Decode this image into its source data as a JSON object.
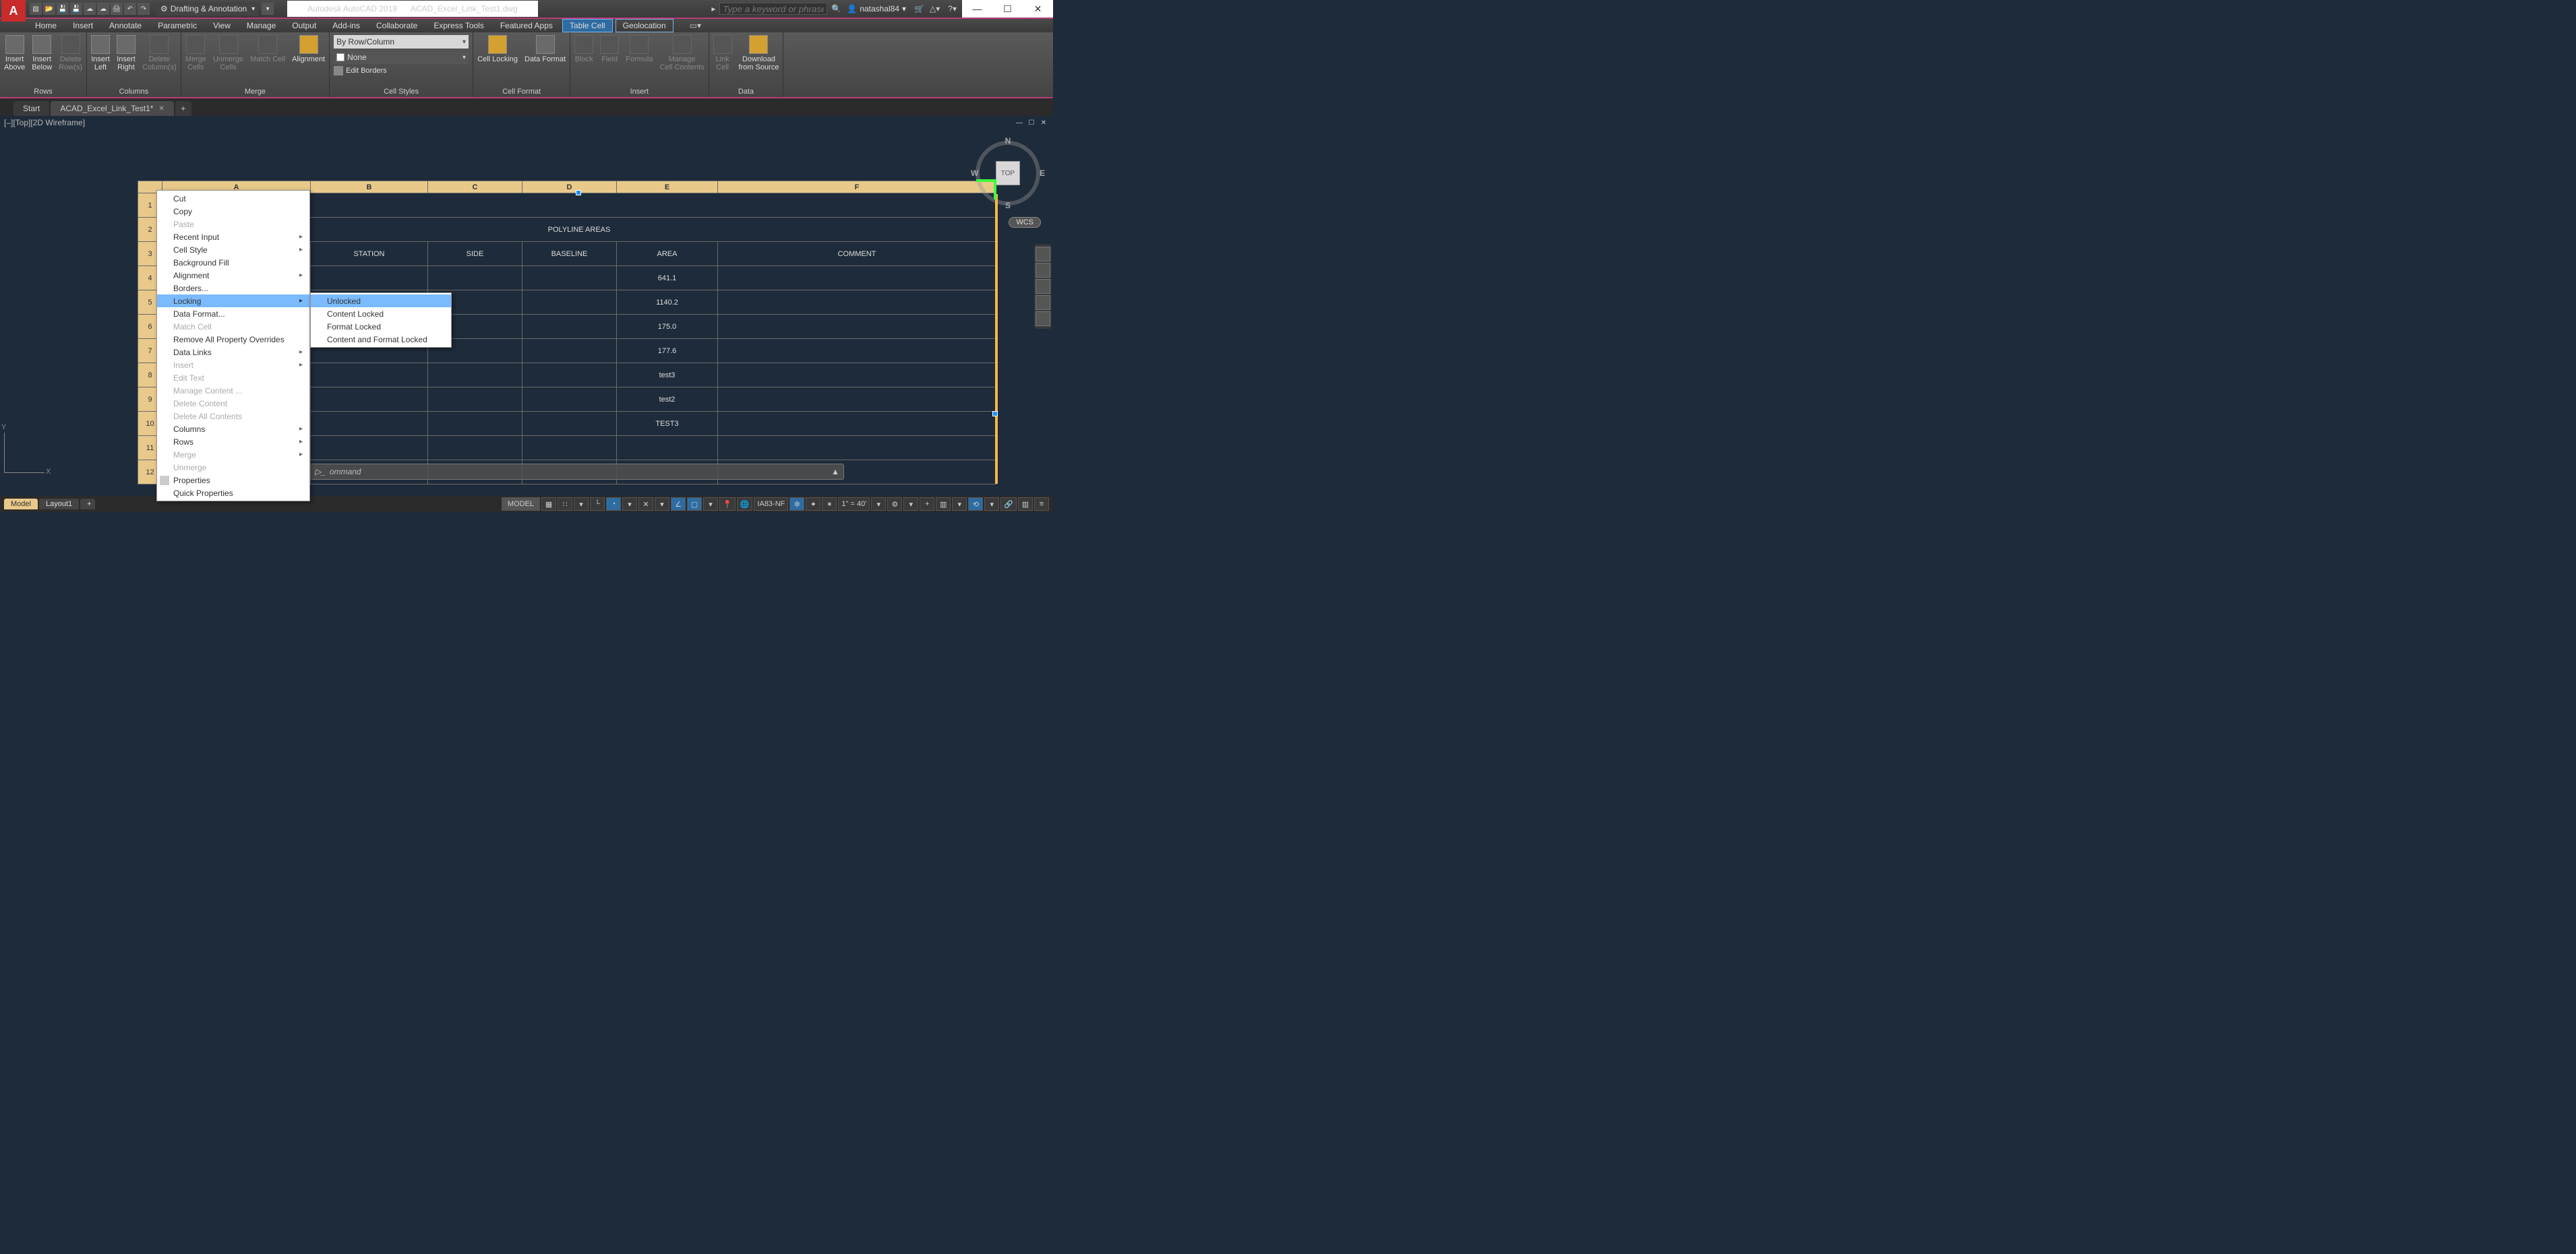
{
  "titlebar": {
    "app_letter": "A",
    "workspace": "Drafting & Annotation",
    "app_name": "Autodesk AutoCAD 2019",
    "document": "ACAD_Excel_Link_Test1.dwg",
    "search_placeholder": "Type a keyword or phrase",
    "username": "natashal84",
    "win_min": "—",
    "win_max": "☐",
    "win_close": "✕"
  },
  "menutabs": {
    "items": [
      "Home",
      "Insert",
      "Annotate",
      "Parametric",
      "View",
      "Manage",
      "Output",
      "Add-ins",
      "Collaborate",
      "Express Tools",
      "Featured Apps",
      "Table Cell",
      "Geolocation"
    ],
    "active_index": 11,
    "secondary_active_index": 12
  },
  "ribbon": {
    "rows": {
      "label": "Rows",
      "insert_above": "Insert\nAbove",
      "insert_below": "Insert\nBelow",
      "delete_rows": "Delete\nRow(s)"
    },
    "columns": {
      "label": "Columns",
      "insert_left": "Insert\nLeft",
      "insert_right": "Insert\nRight",
      "delete_cols": "Delete\nColumn(s)"
    },
    "merge": {
      "label": "Merge",
      "merge": "Merge\nCells",
      "unmerge": "Unmerge\nCells",
      "match": "Match Cell",
      "alignment": "Alignment"
    },
    "cellstyles": {
      "label": "Cell Styles",
      "by_row": "By Row/Column",
      "none": "None",
      "edit_borders": "Edit Borders"
    },
    "cellformat": {
      "label": "Cell Format",
      "cell_locking": "Cell Locking",
      "data_format": "Data Format"
    },
    "insert": {
      "label": "Insert",
      "block": "Block",
      "field": "Field",
      "formula": "Formula",
      "manage": "Manage\nCell Contents"
    },
    "data": {
      "label": "Data",
      "link": "Link\nCell",
      "download": "Download\nfrom Source"
    }
  },
  "doctabs": {
    "start": "Start",
    "active": "ACAD_Excel_Link_Test1*",
    "plus": "+"
  },
  "viewport": {
    "label": "[–][Top][2D Wireframe]"
  },
  "table": {
    "columns": [
      "A",
      "B",
      "C",
      "D",
      "E",
      "F"
    ],
    "row_labels": [
      "1",
      "2",
      "3",
      "4",
      "5",
      "6",
      "7",
      "8",
      "9",
      "10",
      "11",
      "12"
    ],
    "title": "POLYLINE AREAS",
    "headers": {
      "B": "STATION",
      "C": "SIDE",
      "D": "BASELINE",
      "E": "AREA",
      "F": "COMMENT"
    },
    "areas": [
      "641.1",
      "1140.2",
      "175.0",
      "177.6",
      "test3",
      "test2",
      "TEST3"
    ]
  },
  "context_menu": {
    "items": [
      {
        "label": "Cut",
        "enabled": true
      },
      {
        "label": "Copy",
        "enabled": true
      },
      {
        "label": "Paste",
        "enabled": false
      },
      {
        "label": "Recent Input",
        "enabled": true,
        "sub": true
      },
      {
        "label": "Cell Style",
        "enabled": true,
        "sub": true
      },
      {
        "label": "Background Fill",
        "enabled": true
      },
      {
        "label": "Alignment",
        "enabled": true,
        "sub": true
      },
      {
        "label": "Borders...",
        "enabled": true
      },
      {
        "label": "Locking",
        "enabled": true,
        "sub": true,
        "hover": true
      },
      {
        "label": "Data Format...",
        "enabled": true
      },
      {
        "label": "Match Cell",
        "enabled": false
      },
      {
        "label": "Remove All Property Overrides",
        "enabled": true
      },
      {
        "label": "Data Links",
        "enabled": true,
        "sub": true
      },
      {
        "label": "Insert",
        "enabled": false,
        "sub": true
      },
      {
        "label": "Edit Text",
        "enabled": false
      },
      {
        "label": "Manage Content ...",
        "enabled": false
      },
      {
        "label": "Delete Content",
        "enabled": false
      },
      {
        "label": "Delete All Contents",
        "enabled": false
      },
      {
        "label": "Columns",
        "enabled": true,
        "sub": true
      },
      {
        "label": "Rows",
        "enabled": true,
        "sub": true
      },
      {
        "label": "Merge",
        "enabled": false,
        "sub": true
      },
      {
        "label": "Unmerge",
        "enabled": false
      },
      {
        "label": "Properties",
        "enabled": true,
        "icon": true
      },
      {
        "label": "Quick Properties",
        "enabled": true
      }
    ],
    "locking_sub": [
      "Unlocked",
      "Content Locked",
      "Format Locked",
      "Content and Format Locked"
    ]
  },
  "viewcube": {
    "face": "TOP",
    "n": "N",
    "s": "S",
    "e": "E",
    "w": "W",
    "wcs": "WCS"
  },
  "ucs": {
    "x": "X",
    "y": "Y"
  },
  "cmdline": {
    "placeholder": "ommand",
    "tri": "▲"
  },
  "statusbar": {
    "model": "Model",
    "layout1": "Layout1",
    "plus": "+",
    "model_btn": "MODEL",
    "coord": "IA83-NF",
    "scale": "1\" = 40'",
    "globe": "🌐",
    "icons": [
      "▦",
      "∷",
      "▾",
      "└",
      "◔",
      "▾",
      "✕",
      "▾",
      "∠",
      "▢",
      "▾",
      "📍"
    ],
    "right_icons": [
      "✲",
      "✦",
      "✶",
      "▾",
      "⚙",
      "▾",
      "+",
      "▥",
      "▾",
      "⟲",
      "▾",
      "🔗",
      "▥",
      "≡"
    ]
  }
}
